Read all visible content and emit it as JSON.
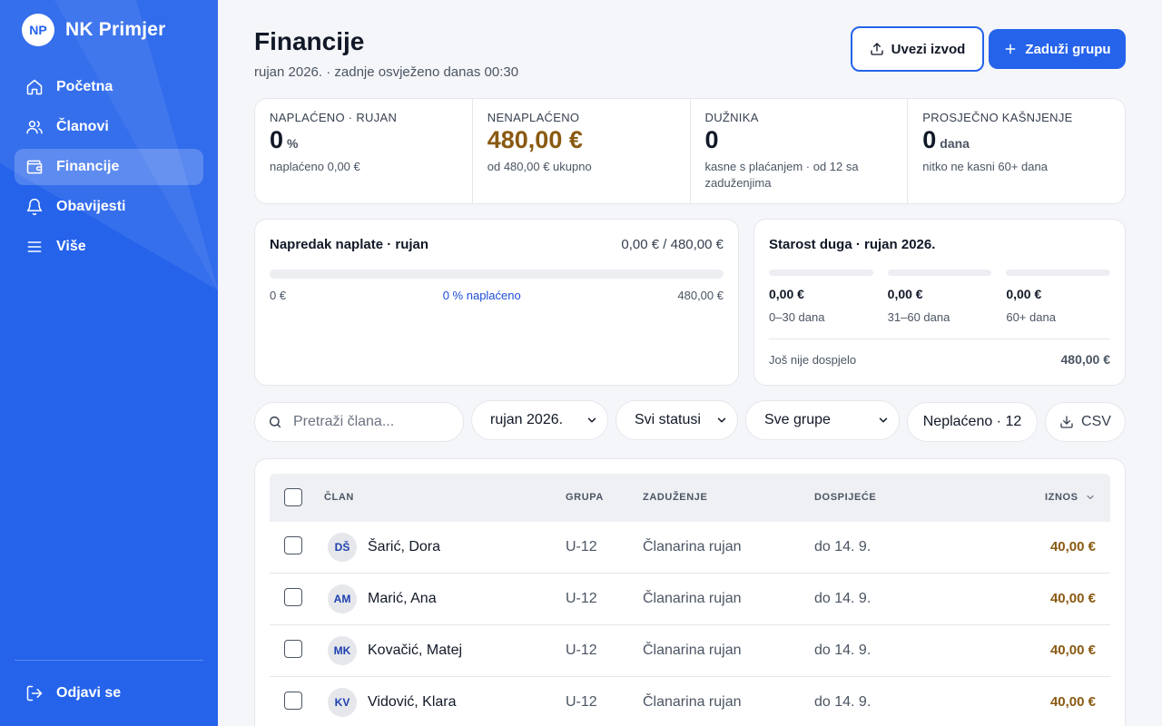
{
  "brand": {
    "logo": "NP",
    "name": "NK Primjer"
  },
  "nav": {
    "items": [
      {
        "label": "Početna",
        "icon": "home-icon"
      },
      {
        "label": "Članovi",
        "icon": "users-icon"
      },
      {
        "label": "Financije",
        "icon": "wallet-icon",
        "active": true
      },
      {
        "label": "Obavijesti",
        "icon": "bell-icon"
      },
      {
        "label": "Više",
        "icon": "menu-icon"
      }
    ],
    "logout": "Odjavi se"
  },
  "header": {
    "title": "Financije",
    "subtitle": "rujan 2026. · zadnje osvježeno danas 00:30",
    "upload_label": "Uvezi izvod",
    "charge_label": "Zaduži grupu"
  },
  "stats": [
    {
      "label": "Naplaćeno · rujan",
      "value": "0",
      "unit": "%",
      "note": "naplaćeno 0,00 €"
    },
    {
      "label": "Nenaplaćeno",
      "value": "480,00 €",
      "unit": "",
      "note": "od 480,00 € ukupno"
    },
    {
      "label": "Dužnika",
      "value": "0",
      "unit": "",
      "note": "kasne s plaćanjem · od 12 sa zaduženjima"
    },
    {
      "label": "Prosječno kašnjenje",
      "value": "0",
      "unit": "dana",
      "note": "nitko ne kasni 60+ dana"
    }
  ],
  "progress": {
    "title": "Napredak naplate · rujan",
    "total": "0,00 € / 480,00 €",
    "fraction": 0,
    "min_label": "0 €",
    "mid_label": "0 % naplaćeno",
    "max_label": "480,00 €"
  },
  "aging": {
    "title": "Starost duga · rujan 2026.",
    "buckets": [
      {
        "amount": "0,00 €",
        "label": "0–30 dana"
      },
      {
        "amount": "0,00 €",
        "label": "31–60 dana"
      },
      {
        "amount": "0,00 €",
        "label": "60+ dana"
      }
    ],
    "not_due_label": "Još nije dospjelo",
    "not_due_value": "480,00 €"
  },
  "filters": {
    "search_placeholder": "Pretraži člana...",
    "month": "rujan 2026.",
    "status": "Svi statusi",
    "group": "Sve grupe",
    "unpaid": "Neplaćeno · 12",
    "csv": "CSV"
  },
  "table": {
    "columns": {
      "member": "ČLAN",
      "group": "GRUPA",
      "charge": "ZADUŽENJE",
      "due": "DOSPIJEĆE",
      "amount": "IZNOS"
    },
    "rows": [
      {
        "initials": "DŠ",
        "name": "Šarić, Dora",
        "group": "U-12",
        "charge": "Članarina rujan",
        "due": "do 14. 9.",
        "amount": "40,00 €"
      },
      {
        "initials": "AM",
        "name": "Marić, Ana",
        "group": "U-12",
        "charge": "Članarina rujan",
        "due": "do 14. 9.",
        "amount": "40,00 €"
      },
      {
        "initials": "MK",
        "name": "Kovačić, Matej",
        "group": "U-12",
        "charge": "Članarina rujan",
        "due": "do 14. 9.",
        "amount": "40,00 €"
      },
      {
        "initials": "KV",
        "name": "Vidović, Klara",
        "group": "U-12",
        "charge": "Članarina rujan",
        "due": "do 14. 9.",
        "amount": "40,00 €"
      }
    ]
  },
  "colors": {
    "primary": "#2563eb",
    "amount": "#8a5a12",
    "background": "#f5f6f9"
  }
}
